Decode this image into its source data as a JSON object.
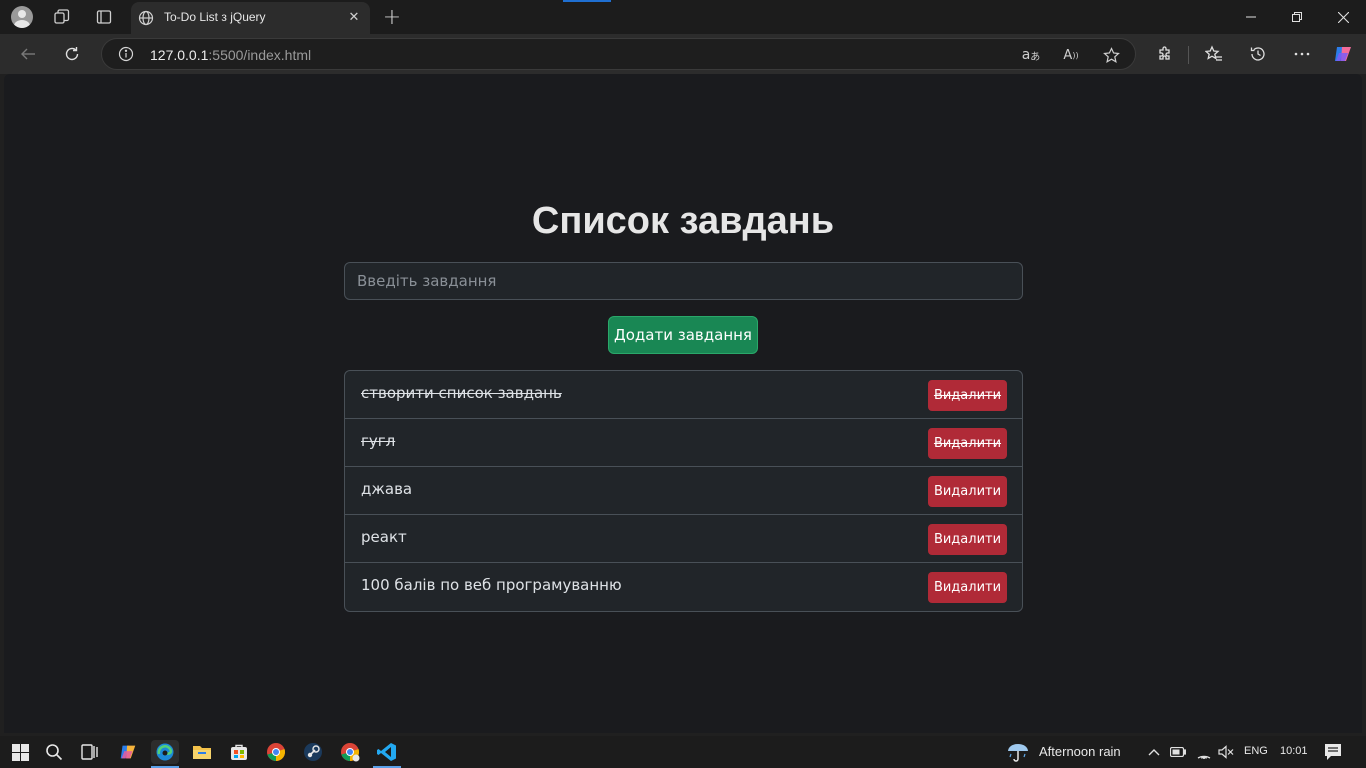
{
  "browser": {
    "tab_title": "To-Do List з jQuery",
    "url_host": "127.0.0.1",
    "url_rest": ":5500/index.html"
  },
  "page": {
    "heading": "Список завдань",
    "input_placeholder": "Введіть завдання",
    "input_value": "",
    "add_button_label": "Додати завдання",
    "tasks": [
      {
        "text": "створити список завдань",
        "done": true,
        "delete_label": "Видалити"
      },
      {
        "text": "гугл",
        "done": true,
        "delete_label": "Видалити"
      },
      {
        "text": "джава",
        "done": false,
        "delete_label": "Видалити"
      },
      {
        "text": "реакт",
        "done": false,
        "delete_label": "Видалити"
      },
      {
        "text": "100 балів по веб програмуванню",
        "done": false,
        "delete_label": "Видалити"
      }
    ]
  },
  "taskbar": {
    "weather": "Afternoon rain",
    "language": "ENG",
    "time": "10:01"
  },
  "colors": {
    "page_bg": "#1a1b1e",
    "success": "#198754",
    "danger": "#b02a37"
  },
  "icons": [
    "profile-icon",
    "workspaces-icon",
    "tab-actions-icon",
    "globe-icon",
    "close-icon",
    "plus-icon",
    "minimize-icon",
    "maximize-icon",
    "window-close-icon",
    "back-icon",
    "reload-icon",
    "info-icon",
    "translate-icon",
    "read-aloud-icon",
    "star-icon",
    "extensions-icon",
    "favorites-icon",
    "history-icon",
    "more-icon",
    "copilot-icon",
    "windows-start-icon",
    "search-icon",
    "task-view-icon",
    "edge-icon",
    "file-explorer-icon",
    "store-icon",
    "chrome-icon",
    "steam-icon",
    "vscode-icon",
    "weather-rain-icon",
    "chevron-up-icon",
    "battery-icon",
    "wifi-icon",
    "volume-muted-icon",
    "notification-icon"
  ]
}
